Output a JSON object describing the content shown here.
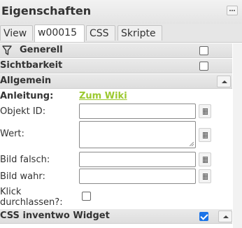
{
  "panel": {
    "title": "Eigenschaften",
    "menu_icon": "grip-dots-icon"
  },
  "tabs": [
    {
      "label": "View",
      "active": false
    },
    {
      "label": "w00015",
      "active": true
    },
    {
      "label": "CSS",
      "active": false
    },
    {
      "label": "Skripte",
      "active": false
    }
  ],
  "sections": {
    "generell": {
      "label": "Generell",
      "icon": "filter-icon",
      "checked": false
    },
    "sichtbarkeit": {
      "label": "Sichtbarkeit",
      "checked": false
    },
    "allgemein": {
      "label": "Allgemein",
      "collapse_icon": "chevron-up-icon"
    },
    "css_widget": {
      "label": "CSS inventwo Widget",
      "checked": true
    }
  },
  "form": {
    "anleitung_label": "Anleitung:",
    "wiki_link": "Zum Wiki",
    "objekt_id_label": "Objekt ID:",
    "wert_label": "Wert:",
    "bild_falsch_label": "Bild falsch:",
    "bild_wahr_label": "Bild wahr:",
    "klick_label_line1": "Klick",
    "klick_label_line2": "durchlassen?:",
    "klick_checked": false
  },
  "colors": {
    "link": "#9cc92f",
    "checkbox_checked": "#1a73e8"
  }
}
